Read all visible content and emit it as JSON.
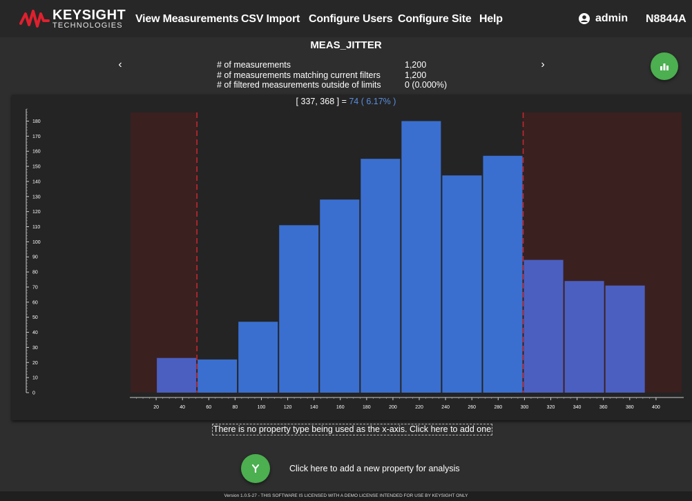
{
  "nav": {
    "brand": "KEYSIGHT",
    "brand_sub": "TECHNOLOGIES",
    "items": [
      "View Measurements",
      "CSV Import",
      "Configure Users",
      "Configure Site",
      "Help"
    ],
    "user": "admin",
    "device": "N8844A",
    "colors": {
      "bar": "#272727",
      "logo_red": "#e0202e"
    }
  },
  "header": {
    "title": "MEAS_JITTER",
    "stats": [
      {
        "label": "# of measurements",
        "value": "1,200"
      },
      {
        "label": "# of measurements matching current filters",
        "value": "1,200"
      },
      {
        "label": "# of filtered measurements outside of limits",
        "value": "0 (0.000%)"
      }
    ],
    "prev_icon": "chevron-left-icon",
    "next_icon": "chevron-right-icon",
    "chart_button_icon": "bar-chart-icon"
  },
  "range_label": {
    "interval": "[ 337, 368 ] = ",
    "count": "74 ( 6.17% )"
  },
  "chart_data": {
    "type": "bar",
    "bin_edges": [
      20,
      51,
      82,
      113,
      144,
      175,
      206,
      237,
      268,
      299,
      330,
      361,
      392
    ],
    "values": [
      23,
      22,
      47,
      111,
      128,
      155,
      180,
      144,
      157,
      88,
      74,
      71
    ],
    "in_limits": [
      false,
      true,
      true,
      true,
      true,
      true,
      true,
      true,
      true,
      false,
      false,
      false
    ],
    "xlim": [
      0,
      420
    ],
    "ylim": [
      0,
      188
    ],
    "x_ticks": [
      20,
      40,
      60,
      80,
      100,
      120,
      140,
      160,
      180,
      200,
      220,
      240,
      260,
      280,
      300,
      320,
      340,
      360,
      380,
      400
    ],
    "y_ticks": [
      0,
      10,
      20,
      30,
      40,
      50,
      60,
      70,
      80,
      90,
      100,
      110,
      120,
      130,
      140,
      150,
      160,
      170,
      180
    ],
    "lower_limit": 51,
    "upper_limit": 299,
    "colors": {
      "bar": "#3a6fd0",
      "bar_out": "#4b5fc0",
      "limit_line": "#d0262e",
      "out_region": "#3b2020"
    }
  },
  "xaxis_note": "There is no property type being used as the x-axis. Click here to add one",
  "add_property": {
    "label": "Click here to add a new property for analysis",
    "icon": "fork-icon"
  },
  "footer": "Version 1.0.5-27 - THIS SOFTWARE IS LICENSED WITH A DEMO LICENSE INTENDED FOR USE BY KEYSIGHT ONLY"
}
